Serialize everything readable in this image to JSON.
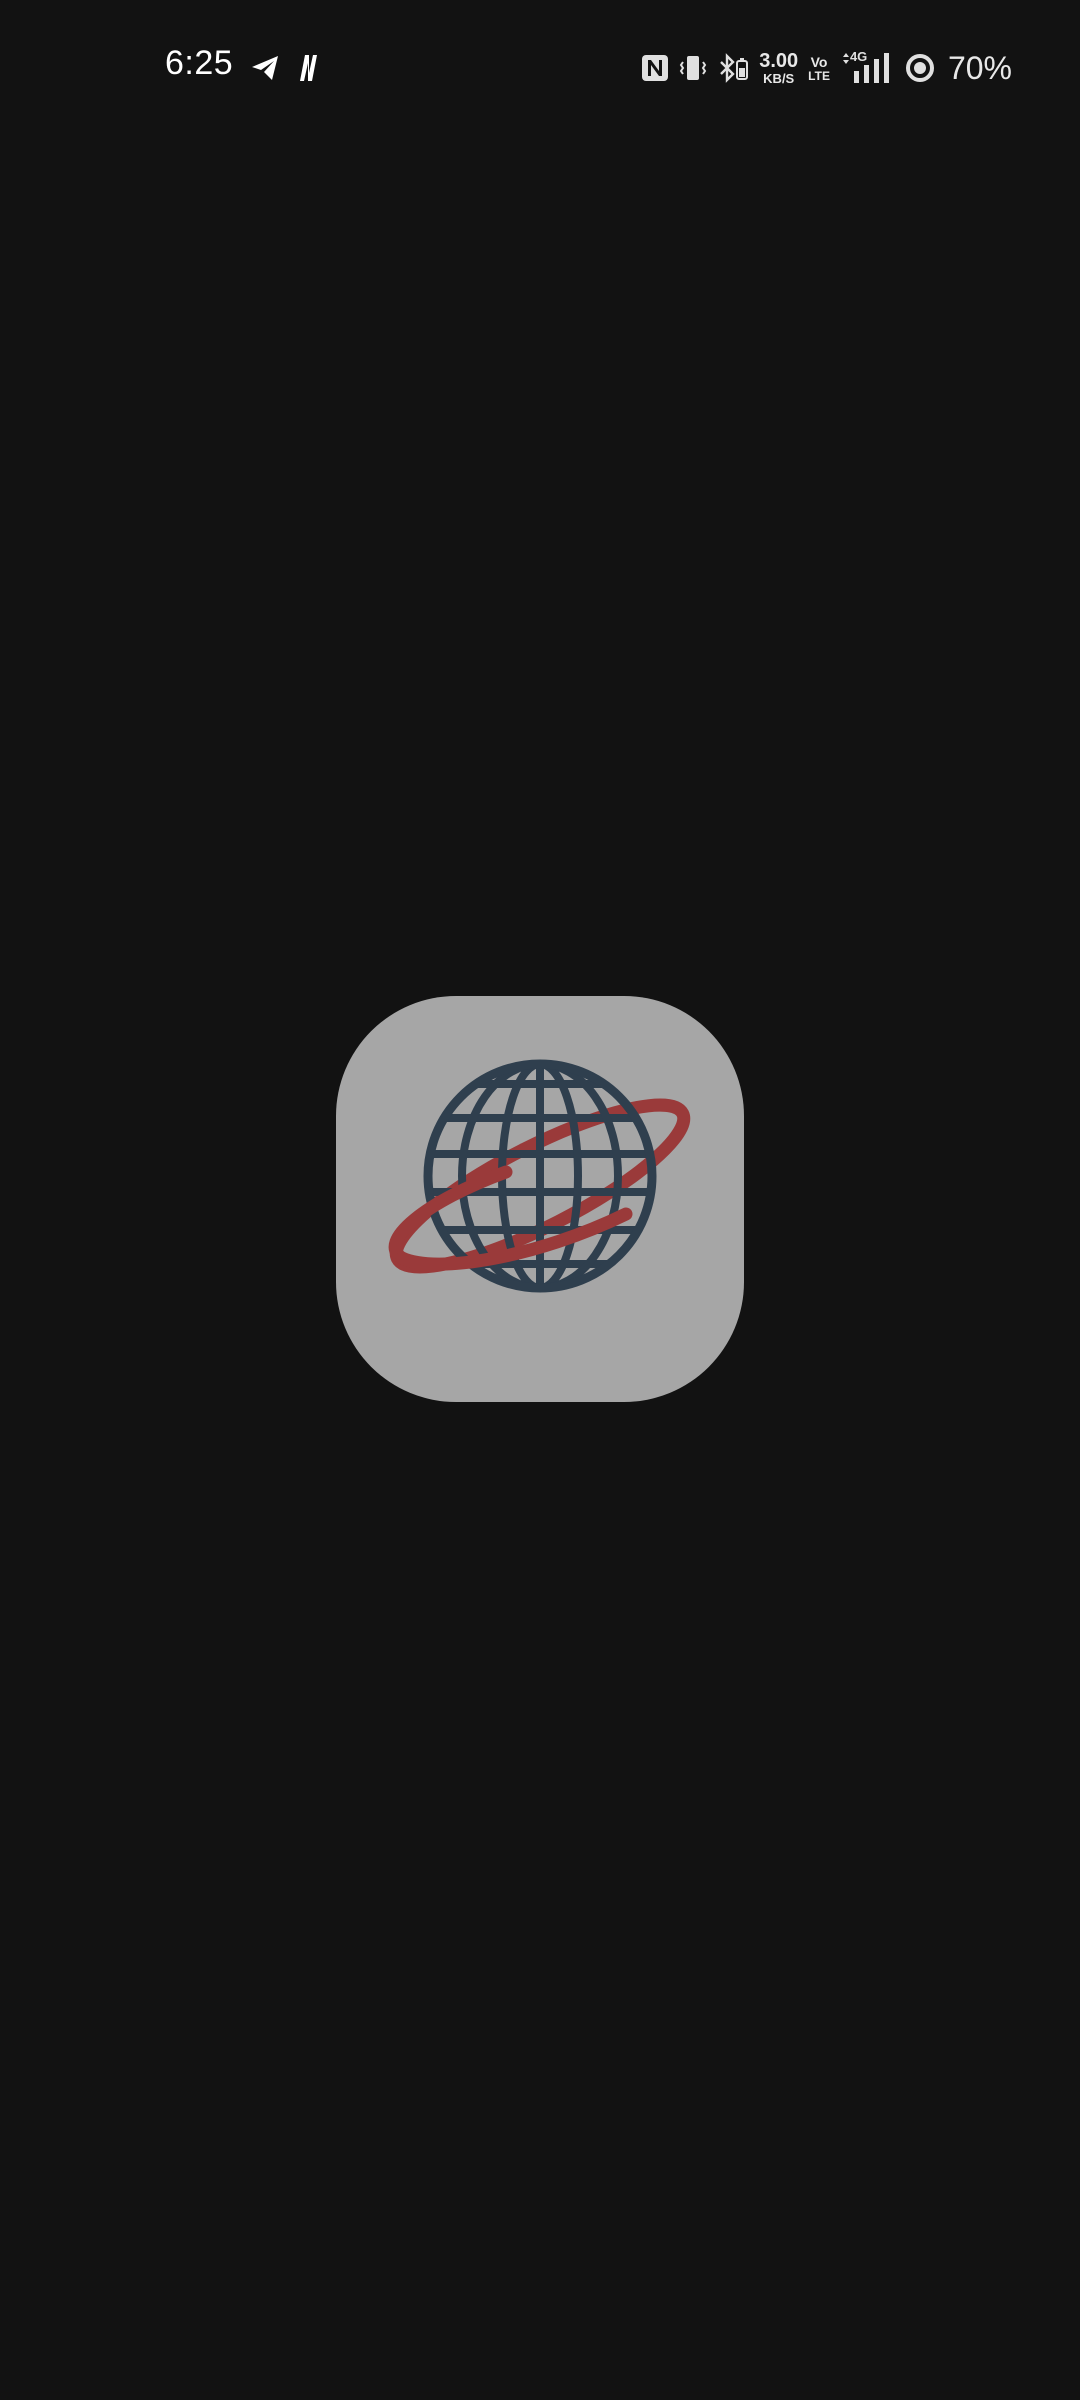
{
  "status_bar": {
    "time": "6:25",
    "left_icons": [
      "telegram-icon",
      "notification-n-icon"
    ],
    "network_speed_value": "3.00",
    "network_speed_unit": "KB/S",
    "volte_top": "Vo",
    "volte_bottom": "LTE",
    "network_type": "4G",
    "battery_percent": "70%",
    "right_icons": [
      "nfc-icon",
      "vibrate-icon",
      "bluetooth-battery-icon",
      "signal-icon",
      "battery-ring-icon"
    ]
  },
  "splash": {
    "logo_icon": "globe-orbit-logo",
    "colors": {
      "background": "#121212",
      "logo_tile": "#a6a6a6",
      "globe": "#2f3f4e",
      "orbit": "#9a3a3a"
    }
  }
}
